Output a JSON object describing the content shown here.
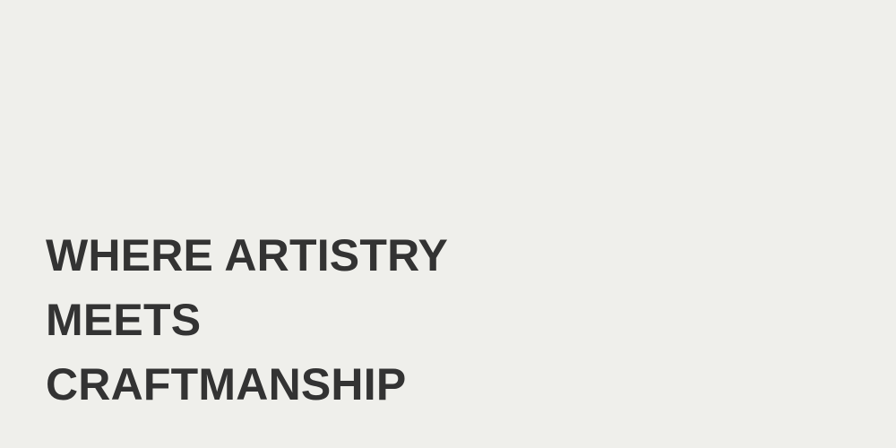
{
  "hero": {
    "lines": [
      "WHERE ARTISTRY",
      "MEETS",
      "CRAFTMANSHIP"
    ],
    "text_color": "#333333"
  },
  "page": {
    "background_color": "#efefeb"
  }
}
